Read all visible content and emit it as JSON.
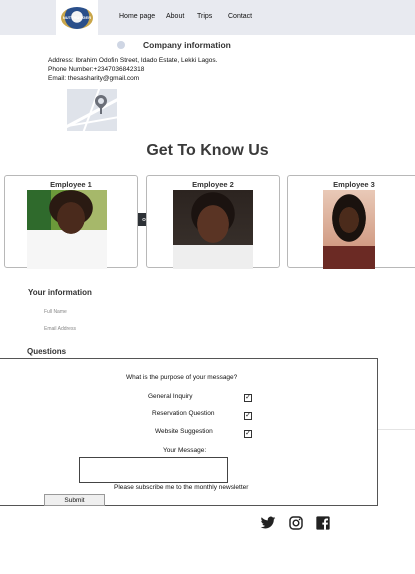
{
  "nav": {
    "logo_text": "NUTTHUGGER",
    "links": [
      "Home page",
      "About",
      "Trips",
      "Contact"
    ]
  },
  "company": {
    "title": "Company information",
    "address": "Address: Ibrahim Odofin Street, Idado Estate, Lekki Lagos.",
    "phone": "Phone Number:+2347036842318",
    "email": "Email: thesasharity@gmail.com"
  },
  "team": {
    "heading": "Get To Know Us",
    "employees": [
      "Employee 1",
      "Employee 2",
      "Employee 3"
    ],
    "sort_tag": "ORT"
  },
  "info": {
    "heading": "Your information",
    "full_name_placeholder": "Full Name",
    "email_placeholder": "Email Address"
  },
  "questions": {
    "heading": "Questions",
    "purpose_prompt": "What is the purpose of your message?",
    "options": [
      "General Inquiry",
      "Reservation Question",
      "Website Suggestion"
    ],
    "check_mark": "✓",
    "message_label": "Your Message:",
    "subscribe_text": "Please subscribe me to the monthly newsletter",
    "submit_label": "Submit"
  },
  "social": [
    "twitter-icon",
    "instagram-icon",
    "facebook-icon"
  ]
}
